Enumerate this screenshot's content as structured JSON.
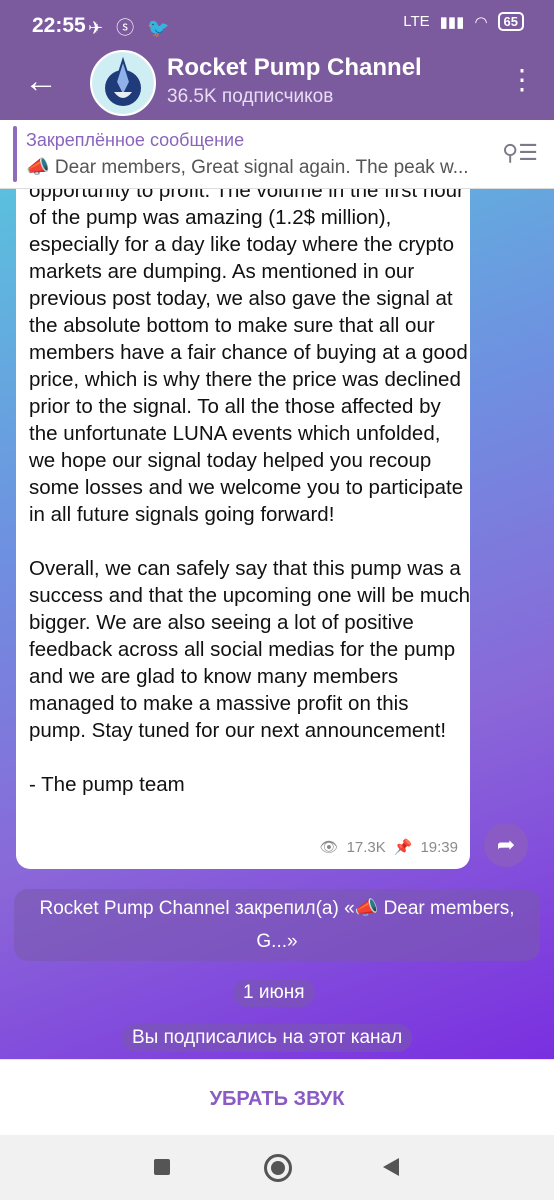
{
  "status": {
    "time": "22:55",
    "icons": "✈ ⓢ 🐦",
    "network": "LTE",
    "battery": "65"
  },
  "header": {
    "title": "Rocket Pump Channel",
    "subtitle": "36.5K подписчиков"
  },
  "pinned": {
    "label": "Закреплённое сообщение",
    "text": "📣 Dear members,  Great signal again. The peak w..."
  },
  "message": {
    "paragraph1": "opportunity to profit. The volume in the first hour of the pump was amazing (1.2$ million), especially for a day like today where the crypto markets are dumping. As mentioned in our previous post today, we also gave the signal at the absolute bottom to make sure that all our members have a fair chance of buying at a good price, which is why there the price was declined prior to the signal. To all the those affected by the unfortunate LUNA events which unfolded, we hope our signal today helped you recoup some losses and we welcome you to participate in all future signals going forward!",
    "paragraph2": "Overall, we can safely say that this pump was a success and that the upcoming one will be much bigger. We are also seeing a lot of positive feedback across all social medias for the pump and we are glad to know many members managed to make a massive profit on this pump. Stay tuned for our next announcement!",
    "signature": "- The pump team",
    "views": "17.3K",
    "time": "19:39"
  },
  "service": {
    "pinned_notice": "Rocket Pump Channel закрепил(а) «📣 Dear members, G...»",
    "date": "1 июня",
    "subscribed": "Вы подписались на этот канал"
  },
  "bottom": {
    "mute_label": "УБРАТЬ ЗВУК"
  }
}
